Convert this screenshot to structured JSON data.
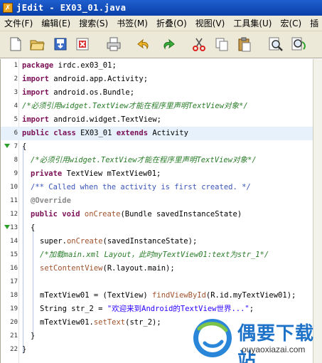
{
  "window": {
    "title": "jEdit - EX03_01.java",
    "icon": "jedit-app-icon"
  },
  "menu": [
    "文件(F)",
    "编辑(E)",
    "搜索(S)",
    "书签(M)",
    "折叠(O)",
    "视图(V)",
    "工具集(U)",
    "宏(C)",
    "插"
  ],
  "toolbar": [
    "new-file-icon",
    "open-folder-icon",
    "save-icon",
    "close-icon",
    "print-icon",
    "undo-icon",
    "redo-icon",
    "cut-icon",
    "copy-icon",
    "paste-icon",
    "find-icon",
    "find-replace-icon"
  ],
  "code": {
    "l1": {
      "n": "1",
      "a": "package",
      "b": " irdc.ex03_01;"
    },
    "l2": {
      "n": "2",
      "a": "import",
      "b": " android.app.Activity;"
    },
    "l3": {
      "n": "3",
      "a": "import",
      "b": " android.os.Bundle;"
    },
    "l4": {
      "n": "4",
      "c": "/*必须引用widget.TextView才能在程序里声明TextView对象*/"
    },
    "l5": {
      "n": "5",
      "a": "import",
      "b": " android.widget.TextView;"
    },
    "l6": {
      "n": "6",
      "a": "public class",
      "b": " EX03_01 ",
      "k": "extends",
      "d": " Activity"
    },
    "l7": {
      "n": "7",
      "b": "{"
    },
    "l8": {
      "n": "8",
      "c": "/*必须引用widget.TextView才能在程序里声明TextView对象*/"
    },
    "l9": {
      "n": "9",
      "a": "private",
      "b": " TextView mTextView01;"
    },
    "l10": {
      "n": "10",
      "c": "/** Called when the activity is first created. */"
    },
    "l11": {
      "n": "11",
      "an": "@Override"
    },
    "l12": {
      "n": "12",
      "a": "public void",
      "f": " onCreate",
      "b": "(Bundle savedInstanceState)"
    },
    "l13": {
      "n": "13",
      "b": "{"
    },
    "l14": {
      "n": "14",
      "b0": "super.",
      "f": "onCreate",
      "b": "(savedInstanceState);"
    },
    "l15": {
      "n": "15",
      "c": "/*加载main.xml Layout，此时myTextView01:text为str_1*/"
    },
    "l16": {
      "n": "16",
      "f": "setContentView",
      "b": "(R.layout.main);"
    },
    "l17": {
      "n": "17"
    },
    "l18": {
      "n": "18",
      "b0": "mTextView01 = (TextView) ",
      "f": "findViewById",
      "b": "(R.id.myTextView01);"
    },
    "l19": {
      "n": "19",
      "b0": "String str_2 = ",
      "s": "\"欢迎来到Android的TextView世界...\"",
      "b": ";"
    },
    "l20": {
      "n": "20",
      "b0": "mTextView01.",
      "f": "setText",
      "b": "(str_2);"
    },
    "l21": {
      "n": "21",
      "b": "}"
    },
    "l22": {
      "n": "22",
      "b": "}"
    }
  },
  "watermark": {
    "title": "偶要下载站",
    "url": "ouyaoxiazai.com"
  }
}
